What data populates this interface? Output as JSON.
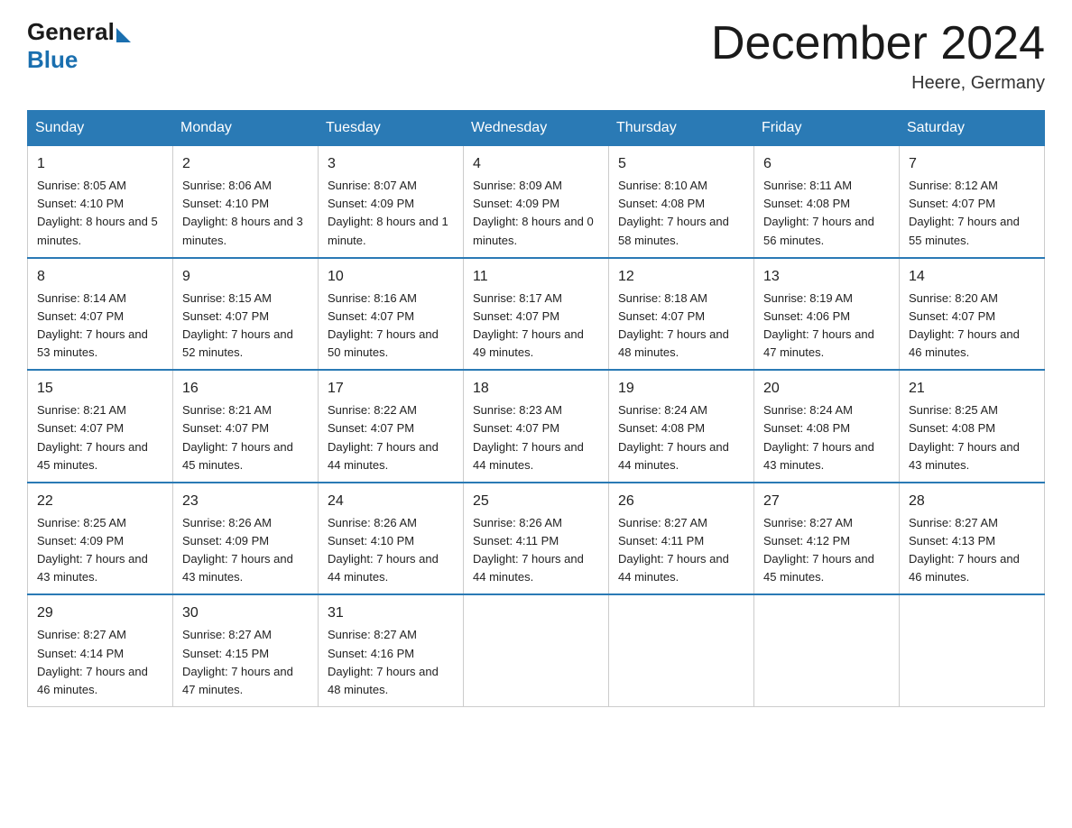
{
  "logo": {
    "general": "General",
    "blue": "Blue"
  },
  "title": "December 2024",
  "location": "Heere, Germany",
  "days_header": [
    "Sunday",
    "Monday",
    "Tuesday",
    "Wednesday",
    "Thursday",
    "Friday",
    "Saturday"
  ],
  "weeks": [
    [
      {
        "day": "1",
        "sunrise": "8:05 AM",
        "sunset": "4:10 PM",
        "daylight": "8 hours and 5 minutes."
      },
      {
        "day": "2",
        "sunrise": "8:06 AM",
        "sunset": "4:10 PM",
        "daylight": "8 hours and 3 minutes."
      },
      {
        "day": "3",
        "sunrise": "8:07 AM",
        "sunset": "4:09 PM",
        "daylight": "8 hours and 1 minute."
      },
      {
        "day": "4",
        "sunrise": "8:09 AM",
        "sunset": "4:09 PM",
        "daylight": "8 hours and 0 minutes."
      },
      {
        "day": "5",
        "sunrise": "8:10 AM",
        "sunset": "4:08 PM",
        "daylight": "7 hours and 58 minutes."
      },
      {
        "day": "6",
        "sunrise": "8:11 AM",
        "sunset": "4:08 PM",
        "daylight": "7 hours and 56 minutes."
      },
      {
        "day": "7",
        "sunrise": "8:12 AM",
        "sunset": "4:07 PM",
        "daylight": "7 hours and 55 minutes."
      }
    ],
    [
      {
        "day": "8",
        "sunrise": "8:14 AM",
        "sunset": "4:07 PM",
        "daylight": "7 hours and 53 minutes."
      },
      {
        "day": "9",
        "sunrise": "8:15 AM",
        "sunset": "4:07 PM",
        "daylight": "7 hours and 52 minutes."
      },
      {
        "day": "10",
        "sunrise": "8:16 AM",
        "sunset": "4:07 PM",
        "daylight": "7 hours and 50 minutes."
      },
      {
        "day": "11",
        "sunrise": "8:17 AM",
        "sunset": "4:07 PM",
        "daylight": "7 hours and 49 minutes."
      },
      {
        "day": "12",
        "sunrise": "8:18 AM",
        "sunset": "4:07 PM",
        "daylight": "7 hours and 48 minutes."
      },
      {
        "day": "13",
        "sunrise": "8:19 AM",
        "sunset": "4:06 PM",
        "daylight": "7 hours and 47 minutes."
      },
      {
        "day": "14",
        "sunrise": "8:20 AM",
        "sunset": "4:07 PM",
        "daylight": "7 hours and 46 minutes."
      }
    ],
    [
      {
        "day": "15",
        "sunrise": "8:21 AM",
        "sunset": "4:07 PM",
        "daylight": "7 hours and 45 minutes."
      },
      {
        "day": "16",
        "sunrise": "8:21 AM",
        "sunset": "4:07 PM",
        "daylight": "7 hours and 45 minutes."
      },
      {
        "day": "17",
        "sunrise": "8:22 AM",
        "sunset": "4:07 PM",
        "daylight": "7 hours and 44 minutes."
      },
      {
        "day": "18",
        "sunrise": "8:23 AM",
        "sunset": "4:07 PM",
        "daylight": "7 hours and 44 minutes."
      },
      {
        "day": "19",
        "sunrise": "8:24 AM",
        "sunset": "4:08 PM",
        "daylight": "7 hours and 44 minutes."
      },
      {
        "day": "20",
        "sunrise": "8:24 AM",
        "sunset": "4:08 PM",
        "daylight": "7 hours and 43 minutes."
      },
      {
        "day": "21",
        "sunrise": "8:25 AM",
        "sunset": "4:08 PM",
        "daylight": "7 hours and 43 minutes."
      }
    ],
    [
      {
        "day": "22",
        "sunrise": "8:25 AM",
        "sunset": "4:09 PM",
        "daylight": "7 hours and 43 minutes."
      },
      {
        "day": "23",
        "sunrise": "8:26 AM",
        "sunset": "4:09 PM",
        "daylight": "7 hours and 43 minutes."
      },
      {
        "day": "24",
        "sunrise": "8:26 AM",
        "sunset": "4:10 PM",
        "daylight": "7 hours and 44 minutes."
      },
      {
        "day": "25",
        "sunrise": "8:26 AM",
        "sunset": "4:11 PM",
        "daylight": "7 hours and 44 minutes."
      },
      {
        "day": "26",
        "sunrise": "8:27 AM",
        "sunset": "4:11 PM",
        "daylight": "7 hours and 44 minutes."
      },
      {
        "day": "27",
        "sunrise": "8:27 AM",
        "sunset": "4:12 PM",
        "daylight": "7 hours and 45 minutes."
      },
      {
        "day": "28",
        "sunrise": "8:27 AM",
        "sunset": "4:13 PM",
        "daylight": "7 hours and 46 minutes."
      }
    ],
    [
      {
        "day": "29",
        "sunrise": "8:27 AM",
        "sunset": "4:14 PM",
        "daylight": "7 hours and 46 minutes."
      },
      {
        "day": "30",
        "sunrise": "8:27 AM",
        "sunset": "4:15 PM",
        "daylight": "7 hours and 47 minutes."
      },
      {
        "day": "31",
        "sunrise": "8:27 AM",
        "sunset": "4:16 PM",
        "daylight": "7 hours and 48 minutes."
      },
      null,
      null,
      null,
      null
    ]
  ]
}
